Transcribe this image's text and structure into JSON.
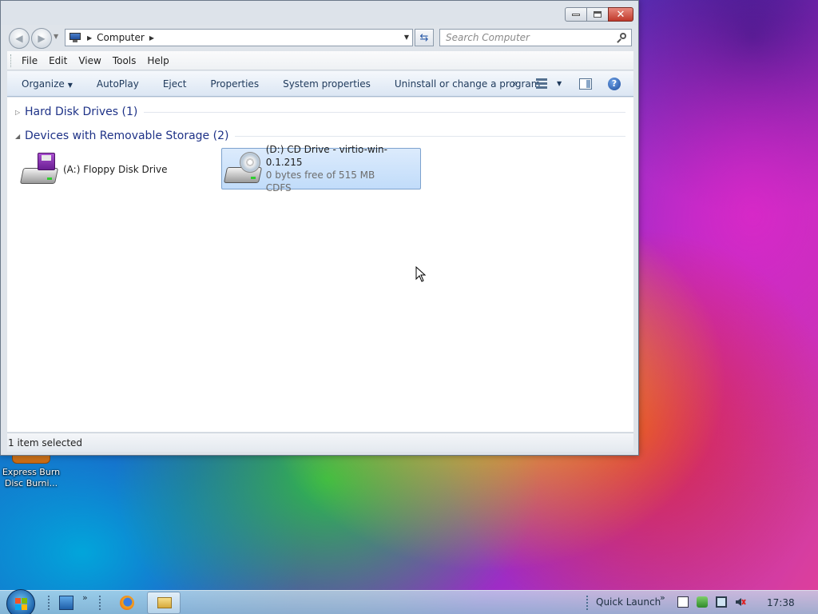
{
  "desktop": {
    "icons": [
      {
        "label": "Express Burn\nDisc Burni..."
      }
    ]
  },
  "window": {
    "address": {
      "crumbs": [
        "Computer"
      ]
    },
    "search": {
      "placeholder": "Search Computer"
    },
    "menubar": {
      "items": [
        "File",
        "Edit",
        "View",
        "Tools",
        "Help"
      ]
    },
    "commandbar": {
      "items": [
        "Organize",
        "AutoPlay",
        "Eject",
        "Properties",
        "System properties",
        "Uninstall or change a program"
      ],
      "more": "»"
    },
    "groups": [
      {
        "title": "Hard Disk Drives (1)",
        "expanded": false
      },
      {
        "title": "Devices with Removable Storage (2)",
        "expanded": true
      }
    ],
    "drives": [
      {
        "name": "(A:) Floppy Disk Drive"
      },
      {
        "name": "(D:) CD Drive - virtio-win-0.1.215",
        "space": "0 bytes free of 515 MB",
        "filesystem": "CDFS",
        "selected": true
      }
    ],
    "status": "1 item selected",
    "colors": {
      "accent": "#1e3287",
      "selection": "#c1dcfa",
      "close": "#c0392b"
    }
  },
  "taskbar": {
    "quick_launch_label": "Quick Launch",
    "time": "17:38"
  }
}
